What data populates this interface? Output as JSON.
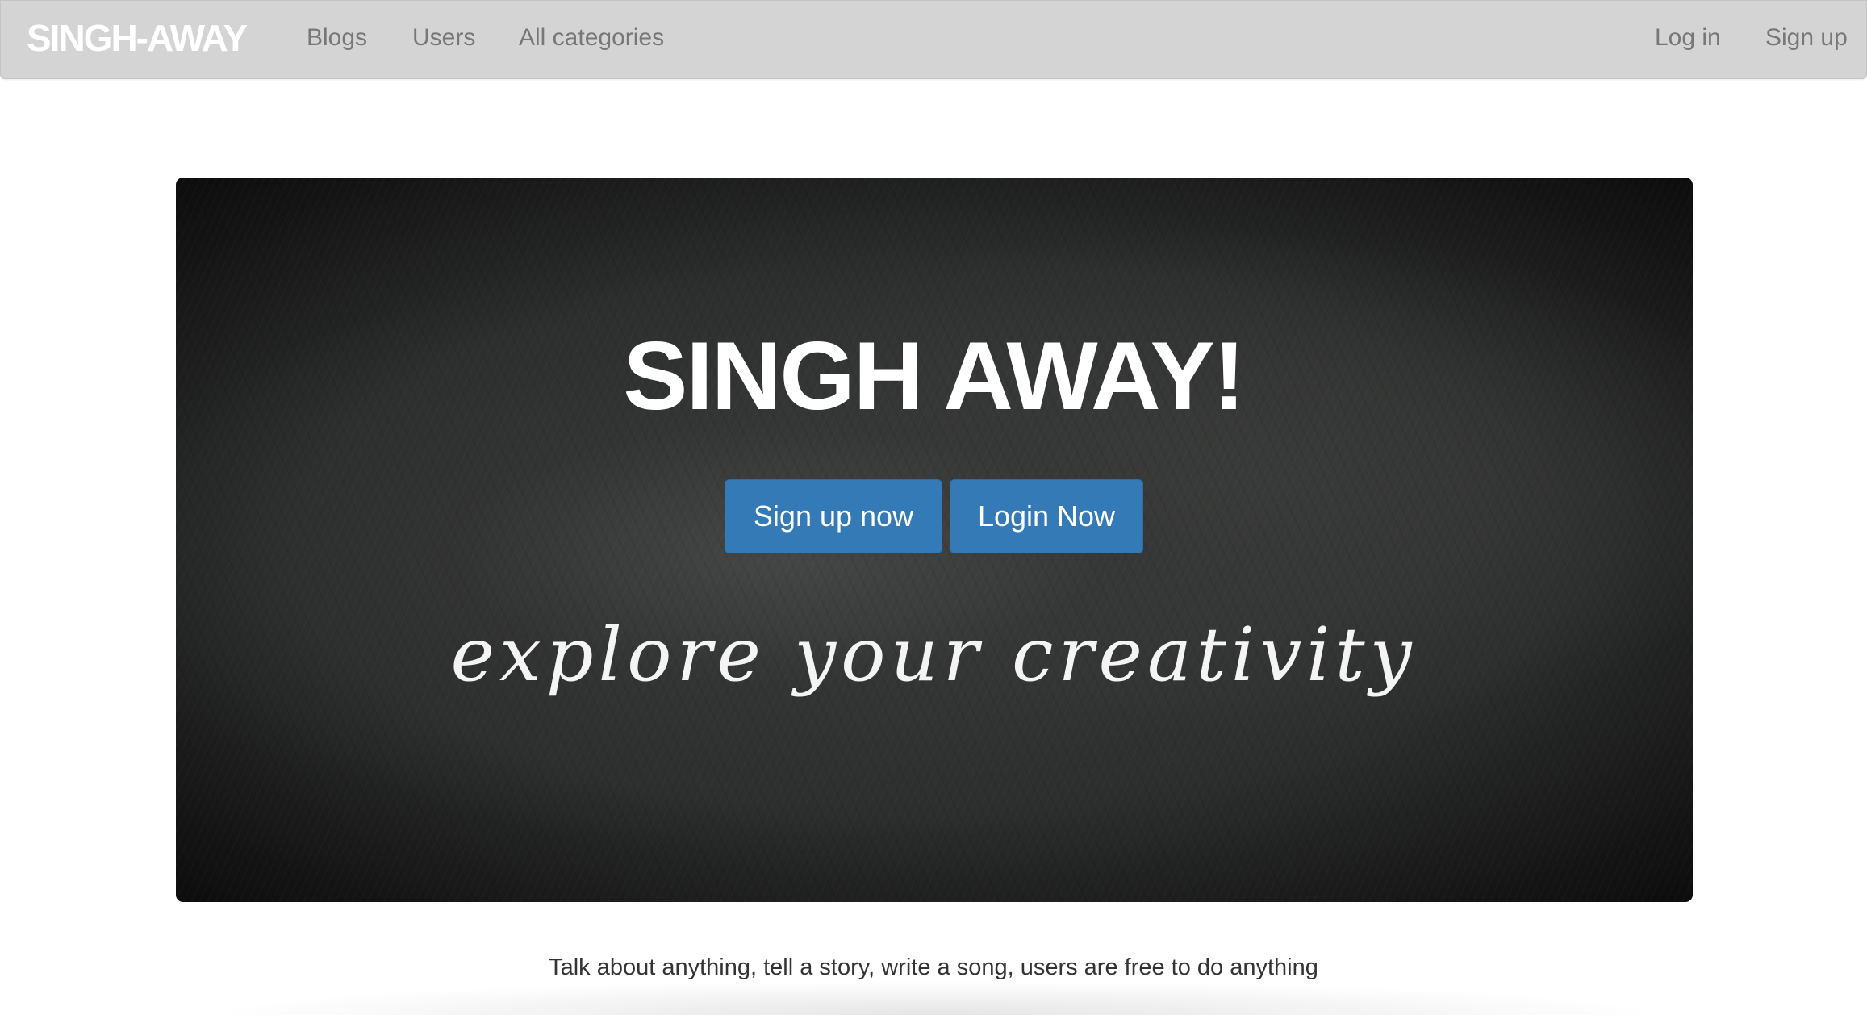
{
  "navbar": {
    "brand": "SINGH-AWAY",
    "links": [
      "Blogs",
      "Users",
      "All categories"
    ],
    "right_links": [
      "Log in",
      "Sign up"
    ]
  },
  "hero": {
    "title": "SINGH AWAY!",
    "signup_button": "Sign up now",
    "login_button": "Login Now",
    "tagline": "explore your creativity"
  },
  "main": {
    "blurb": "Talk about anything, tell a story, write a song, users are free to do anything"
  },
  "colors": {
    "navbar_bg": "#d4d4d4",
    "button_primary": "#337ab7",
    "nav_link": "#777777"
  }
}
